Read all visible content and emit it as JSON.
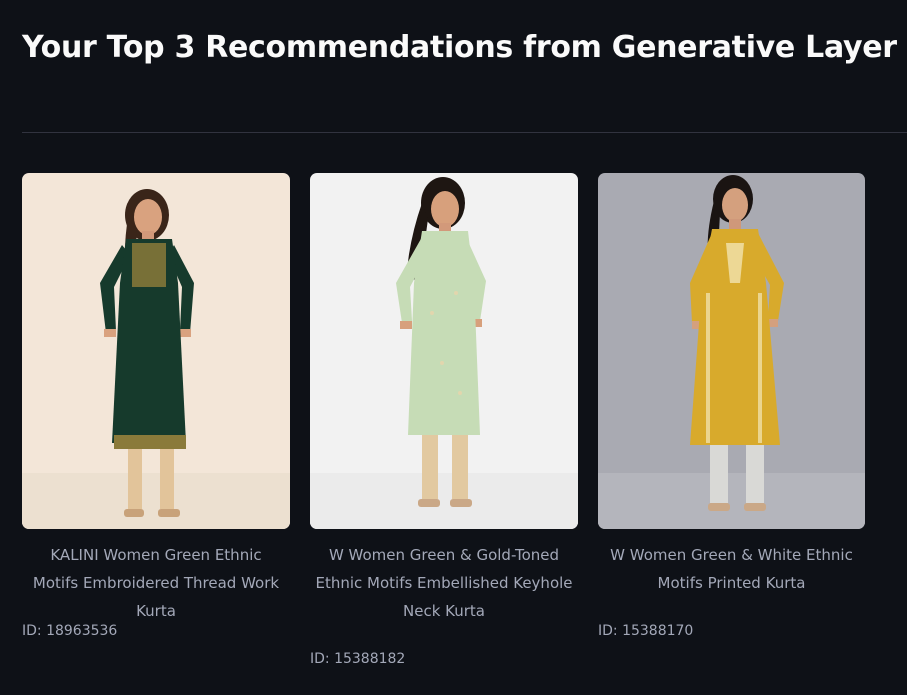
{
  "heading": "Your Top 3 Recommendations from Generative Layer",
  "products": [
    {
      "name": "KALINI Women Green Ethnic Motifs Embroidered Thread Work Kurta",
      "id_label": "ID: 18963536",
      "image_desc": "dark-green-kurta-photo",
      "colors": {
        "background": "#f3e6d8",
        "kurta": "#163a2c",
        "accent": "#8a7a3a"
      }
    },
    {
      "name": "W Women Green & Gold-Toned Ethnic Motifs Embellished Keyhole Neck Kurta",
      "id_label": "ID: 15388182",
      "image_desc": "mint-green-kurta-photo",
      "colors": {
        "background": "#f2f2f2",
        "kurta": "#c6dcb6",
        "accent": "#e2d6ad"
      }
    },
    {
      "name": "W Women Green & White Ethnic Motifs Printed Kurta",
      "id_label": "ID: 15388170",
      "image_desc": "mustard-kurta-photo",
      "colors": {
        "background": "#a9aab2",
        "kurta": "#d8aa2c",
        "accent": "#f2e3b0"
      }
    }
  ]
}
